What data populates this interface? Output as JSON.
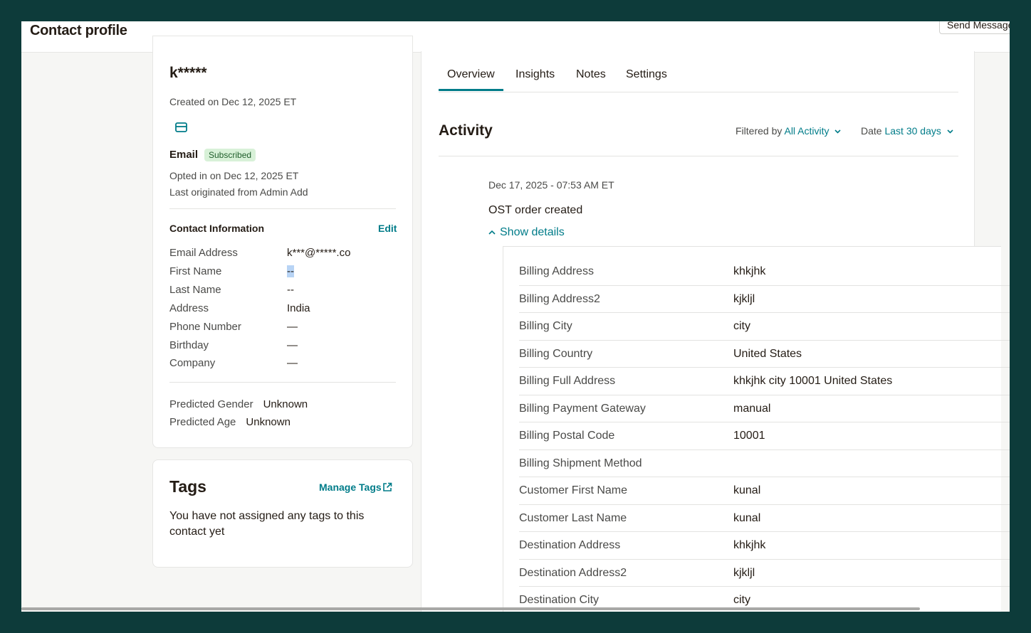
{
  "header": {
    "title": "Contact profile",
    "send_button": "Send Message"
  },
  "profile": {
    "name": "k*****",
    "created": "Created on Dec 12, 2025 ET",
    "email_icon": "mail-icon",
    "email_label": "Email",
    "email_status": "Subscribed",
    "opted_in": "Opted in on Dec 12, 2025 ET",
    "origin": "Last originated from Admin Add",
    "contact_info_title": "Contact Information",
    "edit_label": "Edit",
    "fields": [
      {
        "label": "Email Address",
        "value": "k***@*****.co"
      },
      {
        "label": "First Name",
        "value": "--"
      },
      {
        "label": "Last Name",
        "value": "--"
      },
      {
        "label": "Address",
        "value": "India"
      },
      {
        "label": "Phone Number",
        "value": "—"
      },
      {
        "label": "Birthday",
        "value": "—"
      },
      {
        "label": "Company",
        "value": "—"
      }
    ],
    "predicted": [
      {
        "label": "Predicted Gender",
        "value": "Unknown"
      },
      {
        "label": "Predicted Age",
        "value": "Unknown"
      }
    ]
  },
  "tags": {
    "title": "Tags",
    "manage_label": "Manage Tags",
    "empty_text": "You have not assigned any tags to this contact yet"
  },
  "tabs": [
    "Overview",
    "Insights",
    "Notes",
    "Settings"
  ],
  "activity": {
    "title": "Activity",
    "filtered_label": "Filtered by",
    "filtered_value": "All Activity",
    "date_label": "Date",
    "date_value": "Last 30 days",
    "event": {
      "date": "Dec 17, 2025 - 07:53 AM ET",
      "title": "OST order created",
      "toggle": "Show details",
      "details": [
        {
          "label": "Billing Address",
          "value": "khkjhk"
        },
        {
          "label": "Billing Address2",
          "value": "kjkljl"
        },
        {
          "label": "Billing City",
          "value": "city"
        },
        {
          "label": "Billing Country",
          "value": "United States"
        },
        {
          "label": "Billing Full Address",
          "value": "khkjhk city 10001 United States"
        },
        {
          "label": "Billing Payment Gateway",
          "value": "manual"
        },
        {
          "label": "Billing Postal Code",
          "value": "10001"
        },
        {
          "label": "Billing Shipment Method",
          "value": ""
        },
        {
          "label": "Customer First Name",
          "value": "kunal"
        },
        {
          "label": "Customer Last Name",
          "value": "kunal"
        },
        {
          "label": "Destination Address",
          "value": "khkjhk"
        },
        {
          "label": "Destination Address2",
          "value": "kjkljl"
        },
        {
          "label": "Destination City",
          "value": "city"
        }
      ]
    }
  },
  "colors": {
    "accent": "#007c89",
    "frame_bg": "#0d3b3a",
    "badge_bg": "#d8f1d8"
  }
}
